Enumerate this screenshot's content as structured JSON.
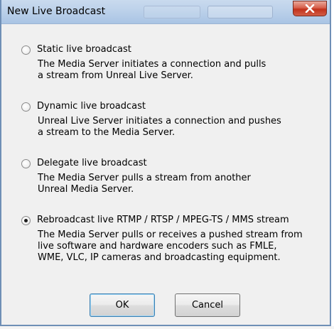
{
  "window": {
    "title": "New Live Broadcast",
    "close_icon": "close-x-icon"
  },
  "options": [
    {
      "label": "Static live broadcast",
      "selected": false,
      "description": [
        "The Media Server initiates a connection and pulls",
        "a stream from Unreal Live Server."
      ]
    },
    {
      "label": "Dynamic live broadcast",
      "selected": false,
      "description": [
        "Unreal Live Server initiates a connection and pushes",
        "a stream to the Media Server."
      ]
    },
    {
      "label": "Delegate live broadcast",
      "selected": false,
      "description": [
        "The Media Server pulls a stream from another",
        "Unreal Media Server."
      ]
    },
    {
      "label": "Rebroadcast live RTMP / RTSP / MPEG-TS / MMS stream",
      "selected": true,
      "description": [
        "The Media Server pulls or receives a pushed stream from",
        "live software and hardware encoders such as FMLE,",
        "WME, VLC, IP cameras and broadcasting equipment."
      ]
    }
  ],
  "buttons": {
    "ok_label": "OK",
    "cancel_label": "Cancel"
  },
  "colors": {
    "title_bar": "#bcd1ea",
    "close_button": "#c1311b",
    "dialog_background": "#f0f0f0",
    "default_button_border": "#3c7fb1"
  }
}
